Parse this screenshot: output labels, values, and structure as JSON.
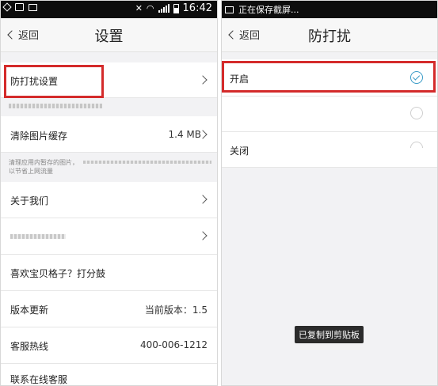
{
  "left": {
    "status": {
      "time": "16:42"
    },
    "nav": {
      "back": "返回",
      "title": "设置"
    },
    "dnd_label": "防打扰设置",
    "cache": {
      "label": "清除图片缓存",
      "value": "1.4 MB"
    },
    "cache_hint": [
      "清理应用内暂存的图片，",
      "以节省上网流量"
    ],
    "about": "关于我们",
    "rate": "喜欢宝贝格子？打分鼓",
    "version": {
      "label": "版本更新",
      "value": "当前版本：1.5"
    },
    "service": {
      "label": "客服热线",
      "value": "400-006-1212"
    },
    "online": "联系在线客服"
  },
  "right": {
    "status": {
      "text": "正在保存截屏..."
    },
    "nav": {
      "back": "返回",
      "title": "防打扰"
    },
    "options": [
      {
        "label": "开启",
        "selected": true
      },
      {
        "label": "",
        "selected": false
      },
      {
        "label": "关闭",
        "selected": false
      }
    ],
    "toast": "已复制到剪贴板"
  },
  "colors": {
    "highlight": "#d42b2b",
    "check": "#3a9bc7"
  }
}
